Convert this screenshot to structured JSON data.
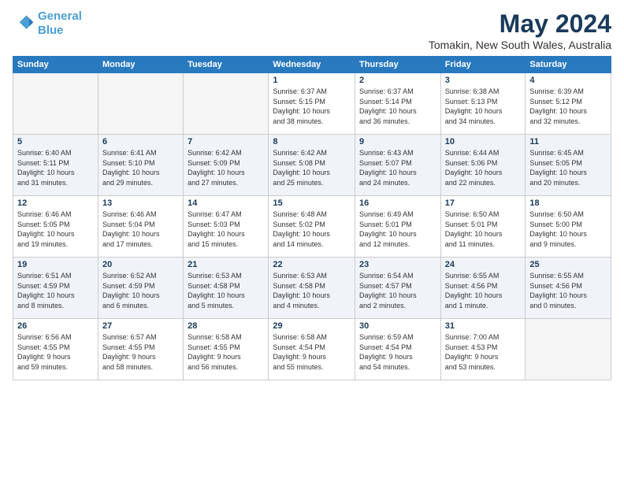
{
  "header": {
    "logo_line1": "General",
    "logo_line2": "Blue",
    "title": "May 2024",
    "subtitle": "Tomakin, New South Wales, Australia"
  },
  "columns": [
    "Sunday",
    "Monday",
    "Tuesday",
    "Wednesday",
    "Thursday",
    "Friday",
    "Saturday"
  ],
  "weeks": [
    {
      "days": [
        {
          "num": "",
          "info": ""
        },
        {
          "num": "",
          "info": ""
        },
        {
          "num": "",
          "info": ""
        },
        {
          "num": "1",
          "info": "Sunrise: 6:37 AM\nSunset: 5:15 PM\nDaylight: 10 hours\nand 38 minutes."
        },
        {
          "num": "2",
          "info": "Sunrise: 6:37 AM\nSunset: 5:14 PM\nDaylight: 10 hours\nand 36 minutes."
        },
        {
          "num": "3",
          "info": "Sunrise: 6:38 AM\nSunset: 5:13 PM\nDaylight: 10 hours\nand 34 minutes."
        },
        {
          "num": "4",
          "info": "Sunrise: 6:39 AM\nSunset: 5:12 PM\nDaylight: 10 hours\nand 32 minutes."
        }
      ]
    },
    {
      "days": [
        {
          "num": "5",
          "info": "Sunrise: 6:40 AM\nSunset: 5:11 PM\nDaylight: 10 hours\nand 31 minutes."
        },
        {
          "num": "6",
          "info": "Sunrise: 6:41 AM\nSunset: 5:10 PM\nDaylight: 10 hours\nand 29 minutes."
        },
        {
          "num": "7",
          "info": "Sunrise: 6:42 AM\nSunset: 5:09 PM\nDaylight: 10 hours\nand 27 minutes."
        },
        {
          "num": "8",
          "info": "Sunrise: 6:42 AM\nSunset: 5:08 PM\nDaylight: 10 hours\nand 25 minutes."
        },
        {
          "num": "9",
          "info": "Sunrise: 6:43 AM\nSunset: 5:07 PM\nDaylight: 10 hours\nand 24 minutes."
        },
        {
          "num": "10",
          "info": "Sunrise: 6:44 AM\nSunset: 5:06 PM\nDaylight: 10 hours\nand 22 minutes."
        },
        {
          "num": "11",
          "info": "Sunrise: 6:45 AM\nSunset: 5:05 PM\nDaylight: 10 hours\nand 20 minutes."
        }
      ]
    },
    {
      "days": [
        {
          "num": "12",
          "info": "Sunrise: 6:46 AM\nSunset: 5:05 PM\nDaylight: 10 hours\nand 19 minutes."
        },
        {
          "num": "13",
          "info": "Sunrise: 6:46 AM\nSunset: 5:04 PM\nDaylight: 10 hours\nand 17 minutes."
        },
        {
          "num": "14",
          "info": "Sunrise: 6:47 AM\nSunset: 5:03 PM\nDaylight: 10 hours\nand 15 minutes."
        },
        {
          "num": "15",
          "info": "Sunrise: 6:48 AM\nSunset: 5:02 PM\nDaylight: 10 hours\nand 14 minutes."
        },
        {
          "num": "16",
          "info": "Sunrise: 6:49 AM\nSunset: 5:01 PM\nDaylight: 10 hours\nand 12 minutes."
        },
        {
          "num": "17",
          "info": "Sunrise: 6:50 AM\nSunset: 5:01 PM\nDaylight: 10 hours\nand 11 minutes."
        },
        {
          "num": "18",
          "info": "Sunrise: 6:50 AM\nSunset: 5:00 PM\nDaylight: 10 hours\nand 9 minutes."
        }
      ]
    },
    {
      "days": [
        {
          "num": "19",
          "info": "Sunrise: 6:51 AM\nSunset: 4:59 PM\nDaylight: 10 hours\nand 8 minutes."
        },
        {
          "num": "20",
          "info": "Sunrise: 6:52 AM\nSunset: 4:59 PM\nDaylight: 10 hours\nand 6 minutes."
        },
        {
          "num": "21",
          "info": "Sunrise: 6:53 AM\nSunset: 4:58 PM\nDaylight: 10 hours\nand 5 minutes."
        },
        {
          "num": "22",
          "info": "Sunrise: 6:53 AM\nSunset: 4:58 PM\nDaylight: 10 hours\nand 4 minutes."
        },
        {
          "num": "23",
          "info": "Sunrise: 6:54 AM\nSunset: 4:57 PM\nDaylight: 10 hours\nand 2 minutes."
        },
        {
          "num": "24",
          "info": "Sunrise: 6:55 AM\nSunset: 4:56 PM\nDaylight: 10 hours\nand 1 minute."
        },
        {
          "num": "25",
          "info": "Sunrise: 6:55 AM\nSunset: 4:56 PM\nDaylight: 10 hours\nand 0 minutes."
        }
      ]
    },
    {
      "days": [
        {
          "num": "26",
          "info": "Sunrise: 6:56 AM\nSunset: 4:55 PM\nDaylight: 9 hours\nand 59 minutes."
        },
        {
          "num": "27",
          "info": "Sunrise: 6:57 AM\nSunset: 4:55 PM\nDaylight: 9 hours\nand 58 minutes."
        },
        {
          "num": "28",
          "info": "Sunrise: 6:58 AM\nSunset: 4:55 PM\nDaylight: 9 hours\nand 56 minutes."
        },
        {
          "num": "29",
          "info": "Sunrise: 6:58 AM\nSunset: 4:54 PM\nDaylight: 9 hours\nand 55 minutes."
        },
        {
          "num": "30",
          "info": "Sunrise: 6:59 AM\nSunset: 4:54 PM\nDaylight: 9 hours\nand 54 minutes."
        },
        {
          "num": "31",
          "info": "Sunrise: 7:00 AM\nSunset: 4:53 PM\nDaylight: 9 hours\nand 53 minutes."
        },
        {
          "num": "",
          "info": ""
        }
      ]
    }
  ]
}
